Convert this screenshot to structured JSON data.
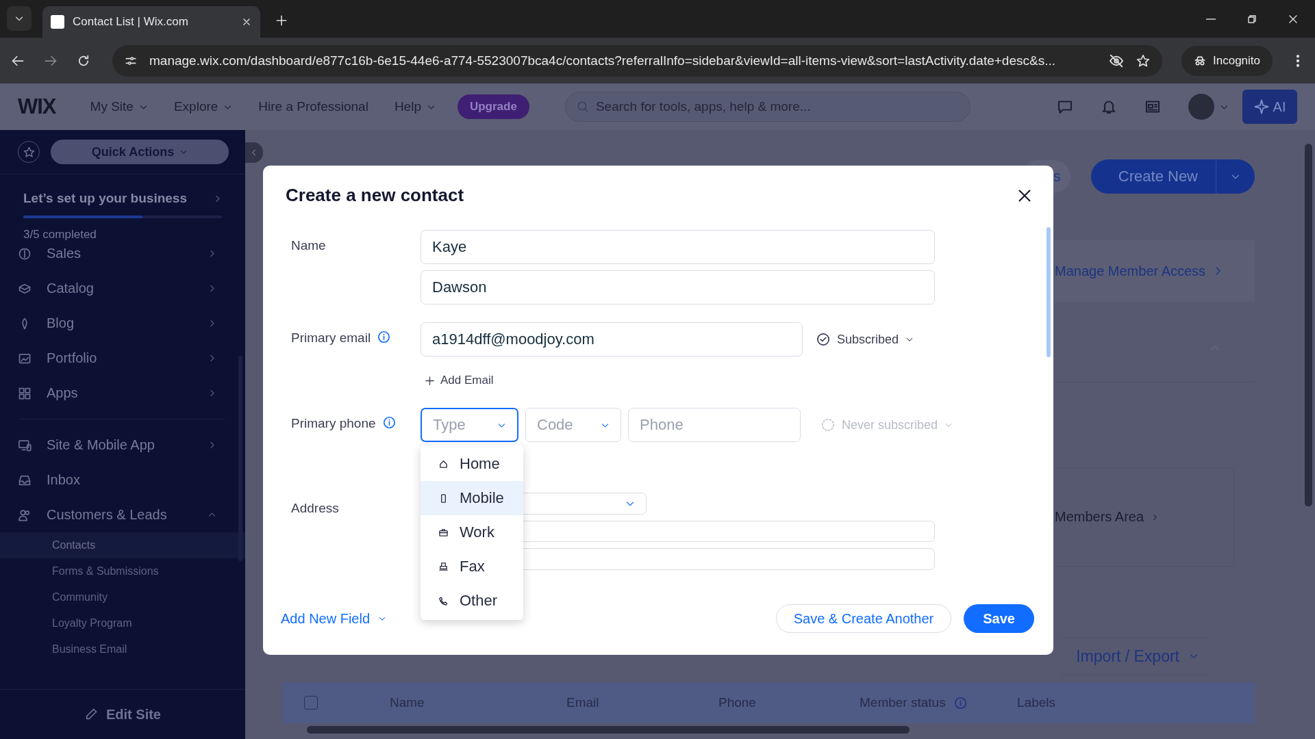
{
  "browser": {
    "tab_title": "Contact List | Wix.com",
    "url": "manage.wix.com/dashboard/e877c16b-6e15-44e6-a774-5523007bca4c/contacts?referralInfo=sidebar&viewId=all-items-view&sort=lastActivity.date+desc&s...",
    "profile": "Incognito"
  },
  "topbar": {
    "logo": "WIX",
    "menu": [
      {
        "label": "My Site",
        "dropdown": true
      },
      {
        "label": "Explore",
        "dropdown": true
      },
      {
        "label": "Hire a Professional",
        "dropdown": false
      },
      {
        "label": "Help",
        "dropdown": true
      }
    ],
    "upgrade": "Upgrade",
    "search": {
      "placeholder": "Search for tools, apps, help & more..."
    },
    "ai": "AI"
  },
  "sidebar": {
    "quick_actions": "Quick Actions",
    "setup": {
      "title": "Let’s set up your business",
      "level": 0.6,
      "progress": "3/5 completed"
    },
    "sections": [
      [
        {
          "label": "Sales",
          "kind": "group",
          "expanded": false
        },
        {
          "label": "Catalog",
          "kind": "group",
          "expanded": false
        },
        {
          "label": "Blog",
          "kind": "group",
          "expanded": false
        },
        {
          "label": "Portfolio",
          "kind": "group",
          "expanded": false
        },
        {
          "label": "Apps",
          "kind": "group",
          "expanded": false
        }
      ],
      [
        {
          "label": "Site & Mobile App",
          "kind": "group",
          "expanded": false
        },
        {
          "label": "Inbox",
          "kind": "link"
        },
        {
          "label": "Customers & Leads",
          "kind": "group",
          "expanded": true,
          "children": [
            {
              "label": "Contacts",
              "selected": true
            },
            {
              "label": "Forms & Submissions",
              "selected": false
            },
            {
              "label": "Community",
              "selected": false
            },
            {
              "label": "Loyalty Program",
              "selected": false
            },
            {
              "label": "Business Email",
              "selected": false
            }
          ]
        }
      ]
    ],
    "edit_site": "Edit Site"
  },
  "background": {
    "partial_button": "s",
    "create_new": "Create New",
    "manage_link": "Manage Member Access",
    "members_area": "Members Area",
    "import_export": "Import / Export",
    "table": {
      "select_all_checked": false,
      "columns": [
        {
          "label": "Name",
          "info": false
        },
        {
          "label": "Email",
          "info": false
        },
        {
          "label": "Phone",
          "info": false
        },
        {
          "label": "Member status",
          "info": true
        },
        {
          "label": "Labels",
          "info": false
        }
      ]
    }
  },
  "modal": {
    "title": "Create a new contact",
    "name": {
      "label": "Name",
      "first": "Kaye",
      "last": "Dawson"
    },
    "email": {
      "label": "Primary email",
      "value": "a1914dff@moodjoy.com",
      "subscription": {
        "label": "Subscribed",
        "subscribed": true
      },
      "add": "Add Email"
    },
    "phone": {
      "label": "Primary phone",
      "type_field": {
        "placeholder": "Type",
        "focused": true
      },
      "code_field": {
        "placeholder": "Code",
        "focused": false
      },
      "phone_field": {
        "placeholder": "Phone"
      },
      "subscription": {
        "label": "Never subscribed",
        "subscribed": false
      },
      "type_menu": [
        {
          "label": "Home",
          "kind": "home",
          "selected": false
        },
        {
          "label": "Mobile",
          "kind": "mobile",
          "selected": true
        },
        {
          "label": "Work",
          "kind": "work",
          "selected": false
        },
        {
          "label": "Fax",
          "kind": "fax",
          "selected": false
        },
        {
          "label": "Other",
          "kind": "other",
          "selected": false
        }
      ]
    },
    "address": {
      "label": "Address"
    },
    "add_field": "Add New Field",
    "secondary_button": "Save & Create Another",
    "primary_button": "Save"
  }
}
